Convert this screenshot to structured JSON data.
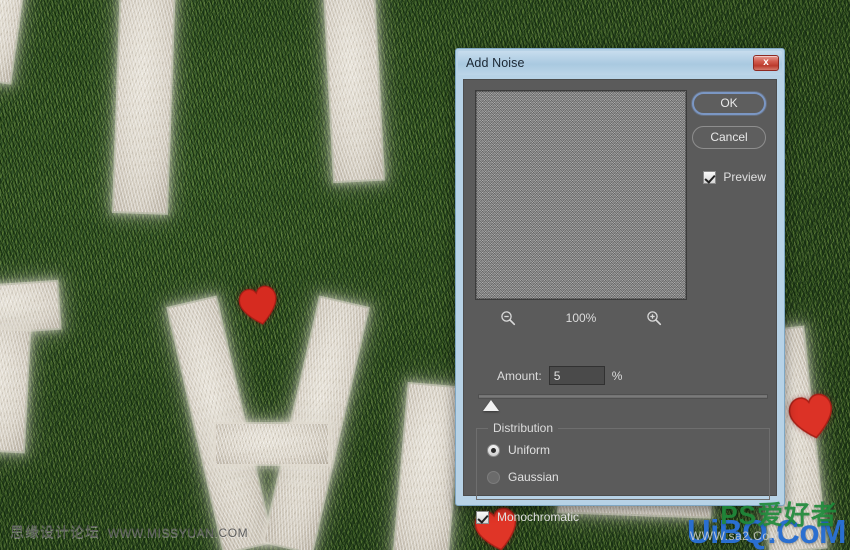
{
  "dialog": {
    "title": "Add Noise",
    "close_label": "x",
    "zoom": {
      "zoom_out_icon": "magnifier-minus-icon",
      "zoom_in_icon": "magnifier-plus-icon",
      "percent": "100%"
    },
    "amount": {
      "label": "Amount:",
      "value": "5",
      "unit": "%",
      "placeholder": "0"
    },
    "distribution": {
      "legend": "Distribution",
      "options": [
        {
          "label": "Uniform",
          "selected": true
        },
        {
          "label": "Gaussian",
          "selected": false
        }
      ]
    },
    "monochromatic": {
      "label": "Monochromatic",
      "checked": true
    },
    "buttons": {
      "ok": "OK",
      "cancel": "Cancel"
    },
    "preview": {
      "label": "Preview",
      "checked": true
    }
  },
  "watermarks": {
    "left_cn": "思缘设计论坛",
    "left_url": "WWW.MISSYUAN.COM",
    "right_main": "UiBQ.CoM",
    "right_overlay": "PS爱好者",
    "right_sub": "WWW.sa2.CoM"
  },
  "colors": {
    "titlebar": "#a9c9e0",
    "dialog_frame": "#b7d2e6",
    "dialog_body": "#5b5b5b",
    "close_button": "#bb3b2d",
    "accent_focus": "#7b97c4",
    "grass": "#2f4d26",
    "letter": "#d8d2c6",
    "heart": "#d62b20",
    "watermark_blue": "#2a6fd0",
    "watermark_green": "#1f8a3a"
  }
}
